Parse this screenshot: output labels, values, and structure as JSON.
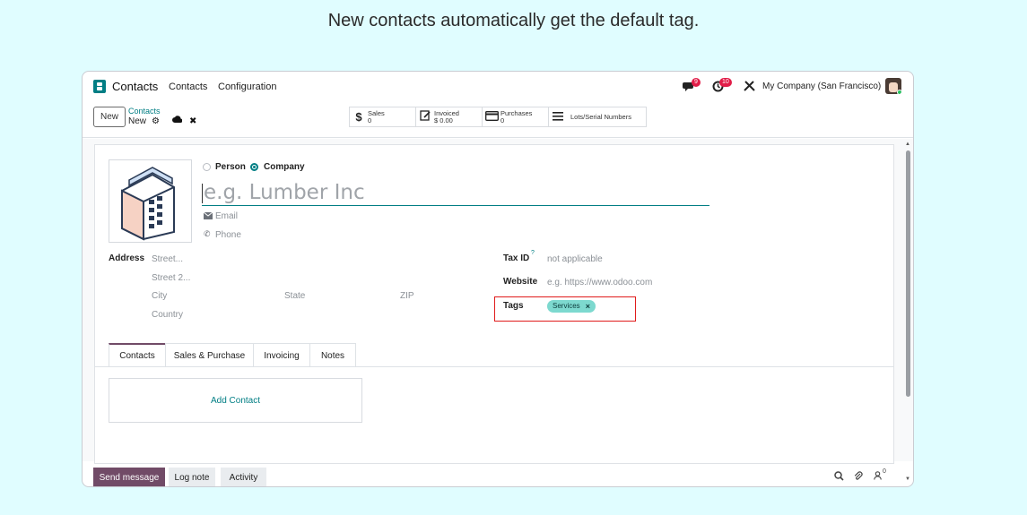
{
  "caption": "New contacts automatically get the default tag.",
  "navbar": {
    "app_name": "Contacts",
    "menu": [
      "Contacts",
      "Configuration"
    ],
    "messages_badge": "9",
    "activities_badge": "10",
    "company": "My Company (San Francisco)"
  },
  "control": {
    "new_label": "New",
    "breadcrumb_parent": "Contacts",
    "breadcrumb_current": "New",
    "smart_buttons": [
      {
        "title": "Sales",
        "value": "0",
        "icon": "dollar-icon"
      },
      {
        "title": "Invoiced",
        "value": "$ 0.00",
        "icon": "invoice-edit-icon"
      },
      {
        "title": "Purchases",
        "value": "0",
        "icon": "credit-card-icon"
      },
      {
        "title": "Lots/Serial Numbers",
        "value": "",
        "icon": "list-icon"
      }
    ]
  },
  "form": {
    "type_person": "Person",
    "type_company": "Company",
    "selected_type": "Company",
    "name_placeholder": "e.g. Lumber Inc",
    "email_placeholder": "Email",
    "phone_placeholder": "Phone",
    "address_label": "Address",
    "street_placeholder": "Street...",
    "street2_placeholder": "Street 2...",
    "city_placeholder": "City",
    "state_placeholder": "State",
    "zip_placeholder": "ZIP",
    "country_placeholder": "Country",
    "taxid_label": "Tax ID",
    "taxid_help": "?",
    "taxid_placeholder": "not applicable",
    "website_label": "Website",
    "website_placeholder": "e.g. https://www.odoo.com",
    "tags_label": "Tags",
    "tag_value": "Services",
    "tag_remove": "×"
  },
  "tabs": [
    "Contacts",
    "Sales & Purchase",
    "Invoicing",
    "Notes"
  ],
  "add_contact_label": "Add Contact",
  "chatter": {
    "send_message": "Send message",
    "log_note": "Log note",
    "activity": "Activity",
    "followers_count": "0"
  },
  "colors": {
    "accent": "#017e84",
    "primary": "#714b67",
    "tag_bg": "#7dd9cf",
    "highlight": "#e01b1b",
    "badge": "#e11d48"
  }
}
